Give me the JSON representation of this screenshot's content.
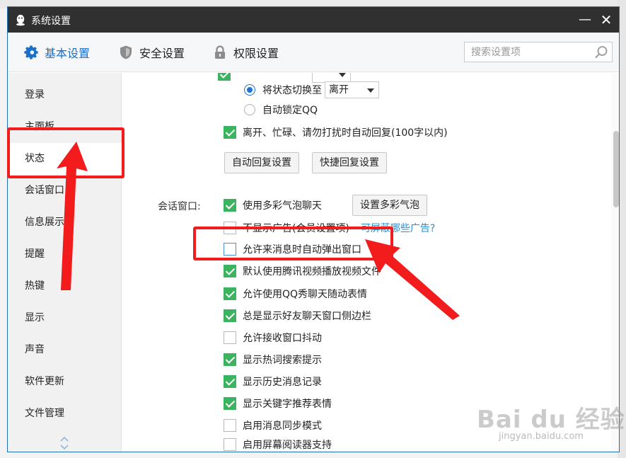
{
  "window": {
    "title": "系统设置",
    "minimize_glyph": "—",
    "close_glyph": "✕"
  },
  "tabs": [
    {
      "label": "基本设置",
      "icon": "gear-icon",
      "active": true
    },
    {
      "label": "安全设置",
      "icon": "shield-icon",
      "active": false
    },
    {
      "label": "权限设置",
      "icon": "lock-icon",
      "active": false
    }
  ],
  "search": {
    "placeholder": "搜索设置项"
  },
  "sidebar": {
    "items": [
      {
        "label": "登录"
      },
      {
        "label": "主面板"
      },
      {
        "label": "状态"
      },
      {
        "label": "会话窗口"
      },
      {
        "label": "信息展示"
      },
      {
        "label": "提醒"
      },
      {
        "label": "热键"
      },
      {
        "label": "显示"
      },
      {
        "label": "声音"
      },
      {
        "label": "软件更新"
      },
      {
        "label": "文件管理"
      }
    ],
    "active_item": "状态"
  },
  "status_section": {
    "switch_status_label": "将状态切换至",
    "switch_status_value": "离开",
    "auto_lock_label": "自动锁定QQ",
    "auto_reply_label": "离开、忙碌、请勿打扰时自动回复(100字以内)",
    "auto_reply_settings_button": "自动回复设置",
    "quick_reply_settings_button": "快捷回复设置"
  },
  "chat_section": {
    "label": "会话窗口:",
    "bubble_setting_button": "设置多彩气泡",
    "ad_link": "可屏蔽哪些广告?",
    "options": [
      {
        "label": "使用多彩气泡聊天",
        "checked": true
      },
      {
        "label": "不显示广告(会员设置项)",
        "checked": false
      },
      {
        "label": "允许来消息时自动弹出窗口",
        "checked": false
      },
      {
        "label": "默认使用腾讯视频播放视频文件",
        "checked": true
      },
      {
        "label": "允许使用QQ秀聊天随动表情",
        "checked": true
      },
      {
        "label": "总是显示好友聊天窗口侧边栏",
        "checked": true
      },
      {
        "label": "允许接收窗口抖动",
        "checked": false
      },
      {
        "label": "显示热词搜索提示",
        "checked": true
      },
      {
        "label": "显示历史消息记录",
        "checked": true
      },
      {
        "label": "显示关键字推荐表情",
        "checked": true
      },
      {
        "label": "启用消息同步模式",
        "checked": false
      },
      {
        "label": "启用屏幕阅读器支持",
        "checked": false
      }
    ]
  },
  "colors": {
    "accent": "#1a6fc9",
    "check_green": "#3bb35f",
    "annotation_red": "#f31c1c",
    "titlebar": "#303030"
  },
  "watermark": {
    "logo": "Bai du 经验",
    "url": "jingyan.baidu.com"
  }
}
